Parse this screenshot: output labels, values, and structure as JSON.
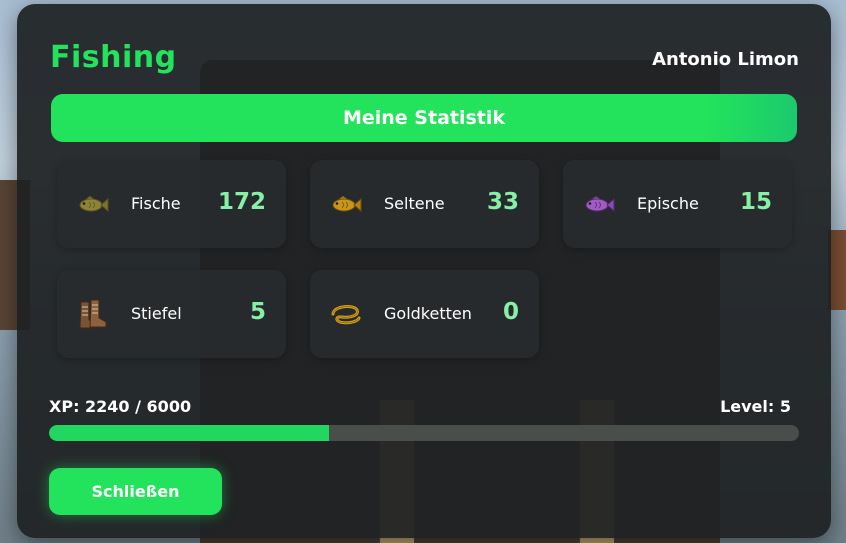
{
  "app": {
    "title": "Fishing",
    "player_name": "Antonio Limon"
  },
  "stats": {
    "header": "Meine Statistik",
    "items": [
      {
        "icon": "fish-icon",
        "label": "Fische",
        "value": "172",
        "color": "#8a7d35"
      },
      {
        "icon": "rare-fish-icon",
        "label": "Seltene",
        "value": "33",
        "color": "#b8860b"
      },
      {
        "icon": "epic-fish-icon",
        "label": "Epische",
        "value": "15",
        "color": "#9b59b6"
      },
      {
        "icon": "boots-icon",
        "label": "Stiefel",
        "value": "5",
        "color": "#7a5234"
      },
      {
        "icon": "gold-chain-icon",
        "label": "Goldketten",
        "value": "0",
        "color": "#d4a017"
      }
    ]
  },
  "progress": {
    "xp_text": "XP: 2240 / 6000",
    "level_text": "Level: 5",
    "xp_current": 2240,
    "xp_max": 6000
  },
  "actions": {
    "close_label": "Schließen"
  },
  "colors": {
    "accent": "#22e35b",
    "value_text": "#86f0a5",
    "panel_bg": "#1e2124"
  }
}
